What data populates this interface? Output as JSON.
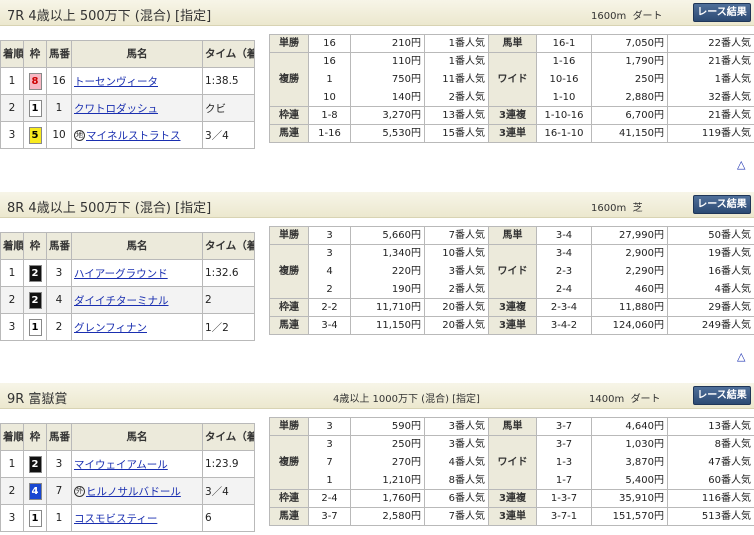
{
  "races": [
    {
      "title": "7R 4歳以上 500万下 (混合) [指定]",
      "subtitle": "",
      "dist": "1600m",
      "surface": "ダート",
      "button": "レース結果",
      "results_header": [
        "着順",
        "枠",
        "馬番",
        "馬名",
        "タイム（着差）"
      ],
      "results": [
        {
          "rank": "1",
          "waku": "8",
          "num": "16",
          "name": "トーセンヴィータ",
          "badge": "",
          "time": "1:38.5"
        },
        {
          "rank": "2",
          "waku": "1",
          "num": "1",
          "name": "クワトロダッシュ",
          "badge": "",
          "time": "クビ"
        },
        {
          "rank": "3",
          "waku": "5",
          "num": "10",
          "name": "マイネルストラトス",
          "badge": "地",
          "time": "3／4"
        }
      ],
      "payouts": {
        "tansho": {
          "label": "単勝",
          "rows": [
            {
              "combo": "16",
              "yen": "210円",
              "pop": "1番人気"
            }
          ]
        },
        "fukusho": {
          "label": "複勝",
          "rows": [
            {
              "combo": "16",
              "yen": "110円",
              "pop": "1番人気"
            },
            {
              "combo": "1",
              "yen": "750円",
              "pop": "11番人気"
            },
            {
              "combo": "10",
              "yen": "140円",
              "pop": "2番人気"
            }
          ]
        },
        "wakuren": {
          "label": "枠連",
          "rows": [
            {
              "combo": "1-8",
              "yen": "3,270円",
              "pop": "13番人気"
            }
          ]
        },
        "umaren": {
          "label": "馬連",
          "rows": [
            {
              "combo": "1-16",
              "yen": "5,530円",
              "pop": "15番人気"
            }
          ]
        },
        "umatan": {
          "label": "馬単",
          "rows": [
            {
              "combo": "16-1",
              "yen": "7,050円",
              "pop": "22番人気"
            }
          ]
        },
        "wide": {
          "label": "ワイド",
          "rows": [
            {
              "combo": "1-16",
              "yen": "1,790円",
              "pop": "21番人気"
            },
            {
              "combo": "10-16",
              "yen": "250円",
              "pop": "1番人気"
            },
            {
              "combo": "1-10",
              "yen": "2,880円",
              "pop": "32番人気"
            }
          ]
        },
        "sanrenpuku": {
          "label": "3連複",
          "rows": [
            {
              "combo": "1-10-16",
              "yen": "6,700円",
              "pop": "21番人気"
            }
          ]
        },
        "sanrentan": {
          "label": "3連単",
          "rows": [
            {
              "combo": "16-1-10",
              "yen": "41,150円",
              "pop": "119番人気"
            }
          ]
        }
      }
    },
    {
      "title": "8R 4歳以上 500万下 (混合) [指定]",
      "subtitle": "",
      "dist": "1600m",
      "surface": "芝",
      "button": "レース結果",
      "results_header": [
        "着順",
        "枠",
        "馬番",
        "馬名",
        "タイム（着差）"
      ],
      "results": [
        {
          "rank": "1",
          "waku": "2",
          "num": "3",
          "name": "ハイアーグラウンド",
          "badge": "",
          "time": "1:32.6"
        },
        {
          "rank": "2",
          "waku": "2",
          "num": "4",
          "name": "ダイイチターミナル",
          "badge": "",
          "time": "2"
        },
        {
          "rank": "3",
          "waku": "1",
          "num": "2",
          "name": "グレンフィナン",
          "badge": "",
          "time": "1／2"
        }
      ],
      "payouts": {
        "tansho": {
          "label": "単勝",
          "rows": [
            {
              "combo": "3",
              "yen": "5,660円",
              "pop": "7番人気"
            }
          ]
        },
        "fukusho": {
          "label": "複勝",
          "rows": [
            {
              "combo": "3",
              "yen": "1,340円",
              "pop": "10番人気"
            },
            {
              "combo": "4",
              "yen": "220円",
              "pop": "3番人気"
            },
            {
              "combo": "2",
              "yen": "190円",
              "pop": "2番人気"
            }
          ]
        },
        "wakuren": {
          "label": "枠連",
          "rows": [
            {
              "combo": "2-2",
              "yen": "11,710円",
              "pop": "20番人気"
            }
          ]
        },
        "umaren": {
          "label": "馬連",
          "rows": [
            {
              "combo": "3-4",
              "yen": "11,150円",
              "pop": "20番人気"
            }
          ]
        },
        "umatan": {
          "label": "馬単",
          "rows": [
            {
              "combo": "3-4",
              "yen": "27,990円",
              "pop": "50番人気"
            }
          ]
        },
        "wide": {
          "label": "ワイド",
          "rows": [
            {
              "combo": "3-4",
              "yen": "2,900円",
              "pop": "19番人気"
            },
            {
              "combo": "2-3",
              "yen": "2,290円",
              "pop": "16番人気"
            },
            {
              "combo": "2-4",
              "yen": "460円",
              "pop": "4番人気"
            }
          ]
        },
        "sanrenpuku": {
          "label": "3連複",
          "rows": [
            {
              "combo": "2-3-4",
              "yen": "11,880円",
              "pop": "29番人気"
            }
          ]
        },
        "sanrentan": {
          "label": "3連単",
          "rows": [
            {
              "combo": "3-4-2",
              "yen": "124,060円",
              "pop": "249番人気"
            }
          ]
        }
      }
    },
    {
      "title": "9R 富嶽賞",
      "subtitle": "4歳以上 1000万下 (混合) [指定]",
      "dist": "1400m",
      "surface": "ダート",
      "button": "レース結果",
      "results_header": [
        "着順",
        "枠",
        "馬番",
        "馬名",
        "タイム（着差）"
      ],
      "results": [
        {
          "rank": "1",
          "waku": "2",
          "num": "3",
          "name": "マイウェイアムール",
          "badge": "",
          "time": "1:23.9"
        },
        {
          "rank": "2",
          "waku": "4",
          "num": "7",
          "name": "ヒルノサルバドール",
          "badge": "外",
          "time": "3／4"
        },
        {
          "rank": "3",
          "waku": "1",
          "num": "1",
          "name": "コスモビスティー",
          "badge": "",
          "time": "6"
        }
      ],
      "payouts": {
        "tansho": {
          "label": "単勝",
          "rows": [
            {
              "combo": "3",
              "yen": "590円",
              "pop": "3番人気"
            }
          ]
        },
        "fukusho": {
          "label": "複勝",
          "rows": [
            {
              "combo": "3",
              "yen": "250円",
              "pop": "3番人気"
            },
            {
              "combo": "7",
              "yen": "270円",
              "pop": "4番人気"
            },
            {
              "combo": "1",
              "yen": "1,210円",
              "pop": "8番人気"
            }
          ]
        },
        "wakuren": {
          "label": "枠連",
          "rows": [
            {
              "combo": "2-4",
              "yen": "1,760円",
              "pop": "6番人気"
            }
          ]
        },
        "umaren": {
          "label": "馬連",
          "rows": [
            {
              "combo": "3-7",
              "yen": "2,580円",
              "pop": "7番人気"
            }
          ]
        },
        "umatan": {
          "label": "馬単",
          "rows": [
            {
              "combo": "3-7",
              "yen": "4,640円",
              "pop": "13番人気"
            }
          ]
        },
        "wide": {
          "label": "ワイド",
          "rows": [
            {
              "combo": "3-7",
              "yen": "1,030円",
              "pop": "8番人気"
            },
            {
              "combo": "1-3",
              "yen": "3,870円",
              "pop": "47番人気"
            },
            {
              "combo": "1-7",
              "yen": "5,400円",
              "pop": "60番人気"
            }
          ]
        },
        "sanrenpuku": {
          "label": "3連複",
          "rows": [
            {
              "combo": "1-3-7",
              "yen": "35,910円",
              "pop": "116番人気"
            }
          ]
        },
        "sanrentan": {
          "label": "3連単",
          "rows": [
            {
              "combo": "3-7-1",
              "yen": "151,570円",
              "pop": "513番人気"
            }
          ]
        }
      }
    }
  ],
  "scroll_top_glyph": "△"
}
